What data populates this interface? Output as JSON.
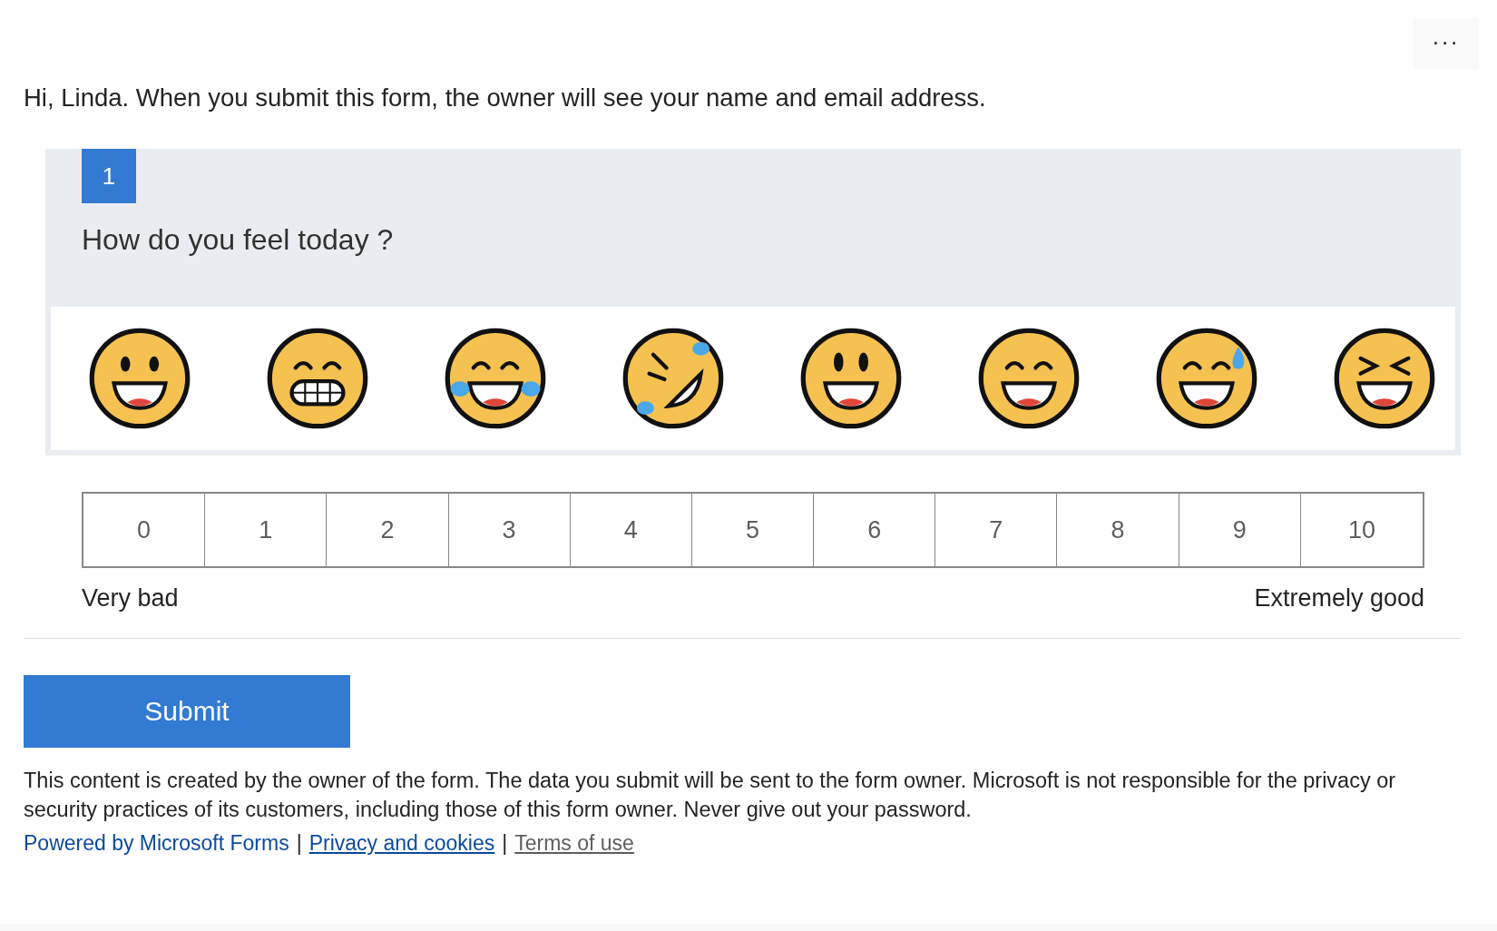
{
  "more_button": {
    "label": "..."
  },
  "greeting": "Hi, Linda. When you submit this form, the owner will see your name and email address.",
  "question": {
    "number": "1",
    "title": "How do you feel today ?",
    "emojis": [
      {
        "kind": "smile"
      },
      {
        "kind": "grimace"
      },
      {
        "kind": "joy"
      },
      {
        "kind": "rofl"
      },
      {
        "kind": "wide"
      },
      {
        "kind": "grin"
      },
      {
        "kind": "sweat"
      },
      {
        "kind": "squint"
      }
    ],
    "scale": [
      {
        "label": "0",
        "selected": false
      },
      {
        "label": "1",
        "selected": false
      },
      {
        "label": "2",
        "selected": false
      },
      {
        "label": "3",
        "selected": false
      },
      {
        "label": "4",
        "selected": false
      },
      {
        "label": "5",
        "selected": false
      },
      {
        "label": "6",
        "selected": false
      },
      {
        "label": "7",
        "selected": false
      },
      {
        "label": "8",
        "selected": false
      },
      {
        "label": "9",
        "selected": false
      },
      {
        "label": "10",
        "selected": false
      }
    ],
    "low_label": "Very bad",
    "high_label": "Extremely good"
  },
  "submit_button": {
    "label": "Submit"
  },
  "disclaimer": "This content is created by the owner of the form. The data you submit will be sent to the form owner. Microsoft is not responsible for the privacy or security practices of its customers, including those of this form owner. Never give out your password.",
  "footer_links": [
    {
      "label": "Powered by Microsoft Forms",
      "kind": "brand"
    },
    {
      "label": "Privacy and cookies",
      "kind": "underlined"
    },
    {
      "label": "Terms of use",
      "kind": "muted"
    }
  ],
  "separator": "|"
}
